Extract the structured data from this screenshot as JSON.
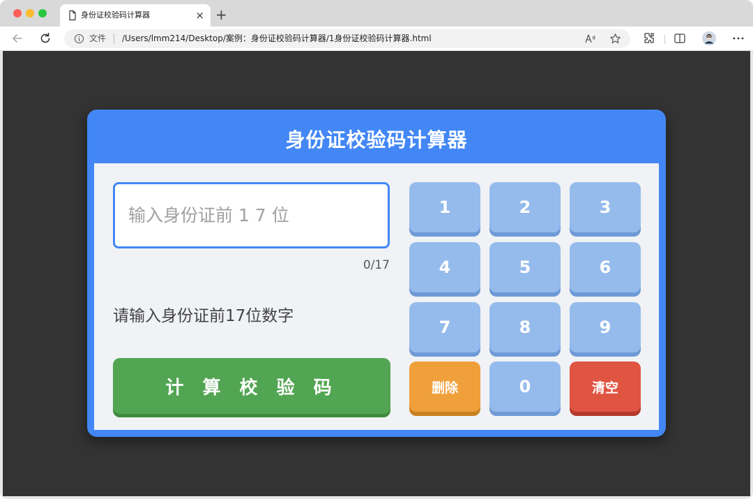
{
  "browser": {
    "tab_title": "身份证校验码计算器",
    "tab_close": "×",
    "new_tab": "+",
    "address_label": "文件",
    "url": "/Users/lmm214/Desktop/案例：身份证校验码计算器/1身份证校验码计算器.html"
  },
  "app": {
    "title": "身份证校验码计算器",
    "input_placeholder": "输入身份证前 1 7 位",
    "input_value": "",
    "counter": "0/17",
    "hint": "请输入身份证前17位数字",
    "calculate_label": "计 算 校 验 码"
  },
  "keypad": {
    "k1": "1",
    "k2": "2",
    "k3": "3",
    "k4": "4",
    "k5": "5",
    "k6": "6",
    "k7": "7",
    "k8": "8",
    "k9": "9",
    "delete": "删除",
    "k0": "0",
    "clear": "清空"
  },
  "colors": {
    "accent": "#4287f5",
    "calculate": "#52a552",
    "digit_key": "#95bbec",
    "delete_key": "#f0a03b",
    "clear_key": "#e05442",
    "page_background": "#333333"
  }
}
